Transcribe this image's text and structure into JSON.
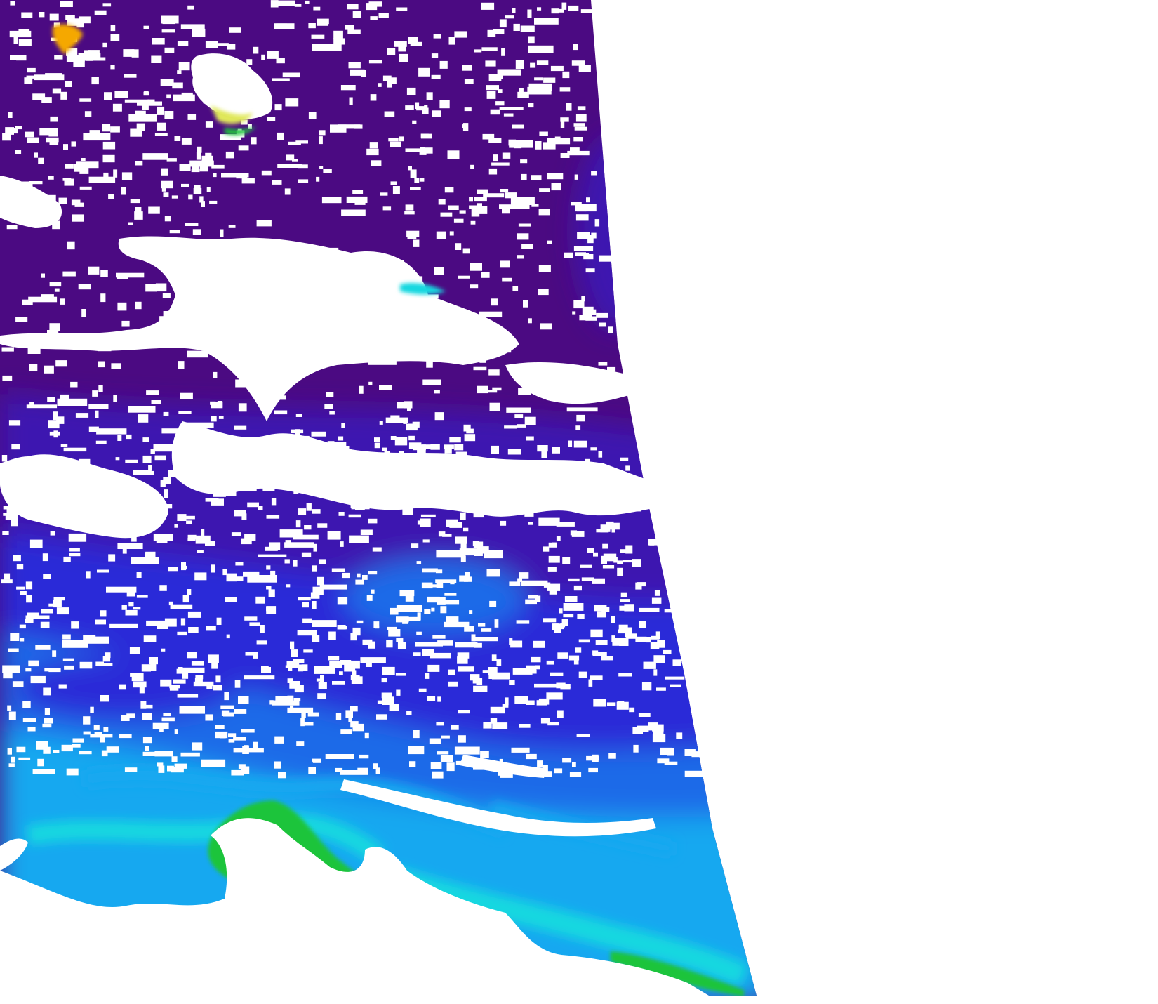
{
  "map": {
    "type": "satellite-swath-colormap",
    "no_data_color": "#ffffff",
    "colormap": [
      "#4a0a7e",
      "#3a10c8",
      "#1e55e8",
      "#10a9f0",
      "#19e0d8",
      "#19c83a",
      "#e8e840",
      "#f5a800"
    ],
    "colors": {
      "deep": "#4b0a82",
      "mid_purple": "#3c12b0",
      "indigo": "#2a2ad8",
      "blue": "#1a6ae8",
      "azure": "#12a8f0",
      "cyan": "#18d8e0",
      "green": "#1cc43a",
      "dark_green": "#0e7a20",
      "yellow": "#e0e85a",
      "orange": "#f5a800",
      "cloud": "#ffffff"
    }
  }
}
